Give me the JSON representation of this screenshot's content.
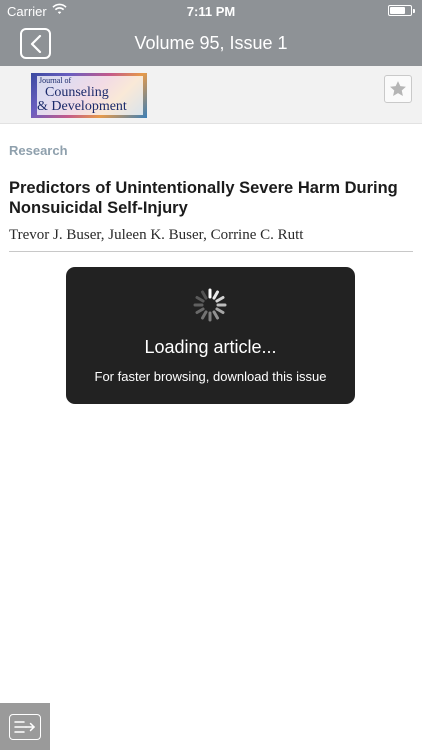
{
  "status_bar": {
    "carrier": "Carrier",
    "time": "7:11 PM"
  },
  "nav": {
    "title": "Volume 95, Issue 1"
  },
  "journal": {
    "logo_line1": "Journal of",
    "logo_line2": "Counseling",
    "logo_line3": "& Development"
  },
  "article": {
    "section": "Research",
    "title": "Predictors of Unintentionally Severe Harm During Nonsuicidal Self-Injury",
    "authors": "Trevor J. Buser, Juleen K. Buser, Corrine C. Rutt"
  },
  "loading": {
    "title": "Loading article...",
    "subtitle": "For faster browsing, download this issue"
  },
  "icons": {
    "back": "chevron-left-icon",
    "favorite": "star-icon",
    "spinner": "spinner-icon",
    "menu": "list-arrow-icon"
  },
  "colors": {
    "nav_bar": "#8e9296",
    "section_label": "#8fa0ad",
    "hud_bg": "#222222"
  }
}
